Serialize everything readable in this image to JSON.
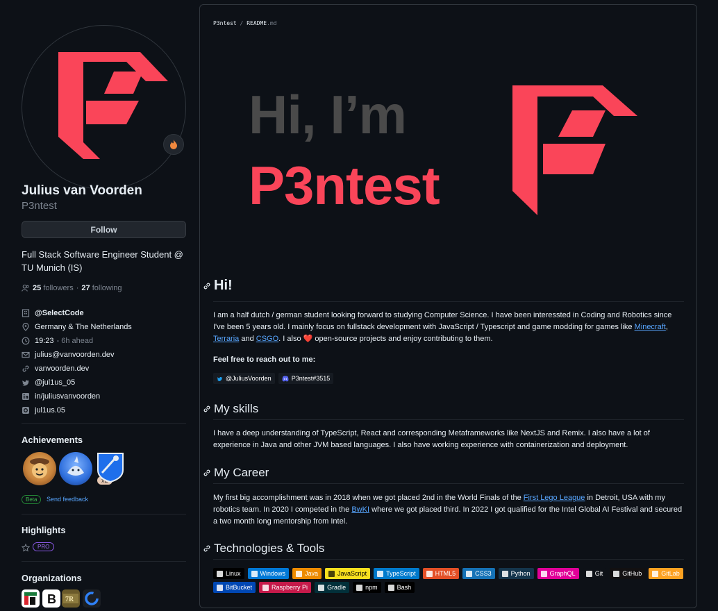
{
  "profile": {
    "fullname": "Julius van Voorden",
    "username": "P3ntest",
    "follow_label": "Follow",
    "bio": "Full Stack Software Engineer Student @ TU Munich (IS)",
    "followers_count": "25",
    "followers_label": "followers",
    "dot": "·",
    "following_count": "27",
    "following_label": "following",
    "status_icon": "fire-icon"
  },
  "details": {
    "company": "@SelectCode",
    "location": "Germany & The Netherlands",
    "time": "19:23",
    "time_offset": "- 6h ahead",
    "email": "julius@vanvoorden.dev",
    "website": "vanvoorden.dev",
    "twitter": "@jul1us_05",
    "linkedin": "in/juliusvanvoorden",
    "instagram": "jul1us.05"
  },
  "achievements": {
    "title": "Achievements",
    "multiplier": "x2",
    "beta_label": "Beta",
    "feedback_label": "Send feedback"
  },
  "highlights": {
    "title": "Highlights",
    "pro_label": "PRO"
  },
  "organizations": {
    "title": "Organizations"
  },
  "readme": {
    "crumb_owner": "P3ntest",
    "crumb_sep": "/",
    "crumb_file": "README",
    "crumb_ext": ".md",
    "hero_greeting": "Hi, I’m",
    "hero_name": "P3ntest",
    "sections": {
      "hi": {
        "title": "Hi!",
        "p1_a": "I am a half dutch / german student looking forward to studying Computer Science. I have been interessted in Coding and Robotics since I've been 5 years old. I mainly focus on fullstack development with JavaScript / Typescript and game modding for games like ",
        "link_minecraft": "Minecraft",
        "p1_b": ",",
        "link_terraria": "Terraria",
        "p1_c": " and ",
        "link_csgo": "CSGO",
        "p1_d": ". I also ",
        "p1_e": " open-source projects and enjoy contributing to them.",
        "reach_out": "Feel free to reach out to me:",
        "twitter_badge": "@JuliusVoorden",
        "discord_badge": "P3ntest#3515"
      },
      "skills": {
        "title": "My skills",
        "text": "I have a deep understanding of TypeScript, React and corresponding Metaframeworks like NextJS and Remix. I also have a lot of experience in Java and other JVM based languages. I also have working experience with containerization and deployment."
      },
      "career": {
        "title": "My Career",
        "t1": "My first big accomplishment was in 2018 when we got placed 2nd in the World Finals of the ",
        "link_fll": "First Lego League",
        "t2": " in Detroit, USA with my robotics team. In 2020 I competed in the ",
        "link_bwki": "BwKI",
        "t3": " where we got placed third. In 2022 I got qualified for the Intel Global AI Festival and secured a two month long mentorship from Intel."
      },
      "tech": {
        "title": "Technologies & Tools",
        "row1": [
          {
            "label": "Linux",
            "bg": "#000000"
          },
          {
            "label": "Windows",
            "bg": "#0078D6"
          },
          {
            "label": "Java",
            "bg": "#ED8B00"
          },
          {
            "label": "JavaScript",
            "bg": "#F7DF1E"
          },
          {
            "label": "TypeScript",
            "bg": "#007ACC"
          },
          {
            "label": "HTML5",
            "bg": "#E34F26"
          },
          {
            "label": "CSS3",
            "bg": "#1572B6"
          },
          {
            "label": "Python",
            "bg": "#14354C"
          },
          {
            "label": "GraphQL",
            "bg": "#E10098"
          },
          {
            "label": "Git",
            "bg": "#0d1117"
          },
          {
            "label": "GitHub",
            "bg": "#121011"
          },
          {
            "label": "GitLab",
            "bg": "#FCA121"
          }
        ],
        "row2": [
          {
            "label": "BitBucket",
            "bg": "#0047B3"
          },
          {
            "label": "Raspberry Pi",
            "bg": "#C51A4A"
          },
          {
            "label": "Gradle",
            "bg": "#02303A"
          },
          {
            "label": "npm",
            "bg": "#000000"
          },
          {
            "label": "Bash",
            "bg": "#000000"
          }
        ]
      }
    }
  },
  "colors": {
    "brand": "#fa4559",
    "link": "#58a6ff",
    "background": "#0d1117"
  }
}
